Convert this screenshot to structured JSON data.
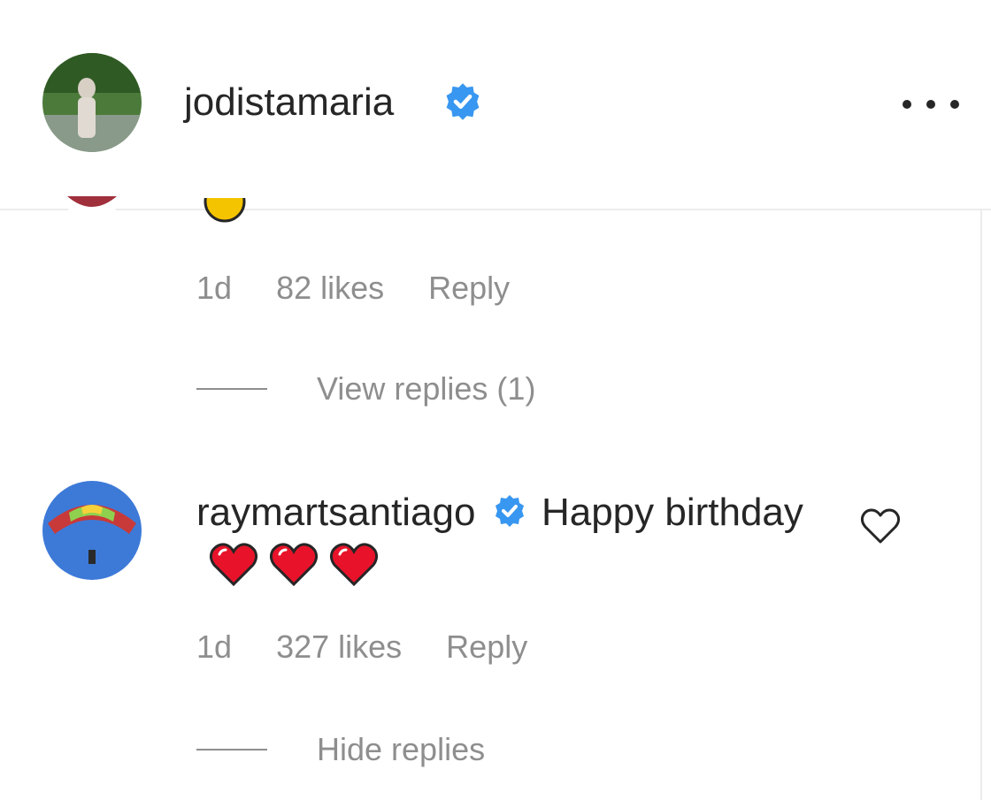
{
  "header": {
    "username": "jodistamaria",
    "verified": true,
    "more_icon": "more-horizontal-icon"
  },
  "previous_comment": {
    "time": "1d",
    "likes": "82 likes",
    "reply_label": "Reply",
    "view_replies_label": "View replies (1)"
  },
  "comment": {
    "username": "raymartsantiago",
    "verified": true,
    "text": "Happy birthday",
    "emoji": [
      "red-heart",
      "red-heart",
      "red-heart"
    ],
    "time": "1d",
    "likes": "327 likes",
    "reply_label": "Reply",
    "hide_replies_label": "Hide replies",
    "like_icon": "heart-outline-icon"
  },
  "colors": {
    "text": "#262626",
    "muted": "#8e8e8e",
    "verified_blue": "#3897f0",
    "heart_red": "#e8132a",
    "divider": "#ececec"
  }
}
